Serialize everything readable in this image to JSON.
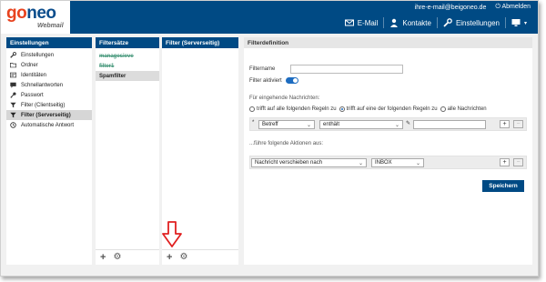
{
  "header": {
    "logo_part1": "go",
    "logo_part2": "neo",
    "logo_sub": "Webmail",
    "email": "ihre-e-mail@beigoneo.de",
    "logout": "Abmelden",
    "nav": {
      "email": "E-Mail",
      "contacts": "Kontakte",
      "settings": "Einstellungen"
    }
  },
  "settings_panel": {
    "title": "Einstellungen",
    "items": [
      {
        "label": "Einstellungen",
        "icon": "wrench-icon"
      },
      {
        "label": "Ordner",
        "icon": "folder-icon"
      },
      {
        "label": "Identitäten",
        "icon": "id-card-icon"
      },
      {
        "label": "Schnellantworten",
        "icon": "reply-icon"
      },
      {
        "label": "Passwort",
        "icon": "key-icon"
      },
      {
        "label": "Filter (Clientseitig)",
        "icon": "filter-icon"
      },
      {
        "label": "Filter (Serverseitig)",
        "icon": "filter-icon"
      },
      {
        "label": "Automatische Antwort",
        "icon": "clock-icon"
      }
    ],
    "active_index": 6
  },
  "filtersets": {
    "title": "Filtersätze",
    "items": [
      "managesieve",
      "filter1",
      "Spamfilter"
    ],
    "selected_index": 2
  },
  "serverfilters": {
    "title": "Filter (Serverseitig)"
  },
  "filterdef": {
    "title": "Filterdefinition",
    "name_label": "Filtername",
    "name_value": "",
    "active_label": "Filter aktiviert",
    "incoming_label": "Für eingehende Nachrichten:",
    "radio_all_rules": "trifft auf alle folgenden Regeln zu",
    "radio_any_rule": "trifft auf eine der folgenden Regeln zu",
    "radio_all_messages": "alle Nachrichten",
    "rule_field": "Betreff",
    "rule_op": "enthält",
    "rule_value": "",
    "actions_label": "...führe folgende Aktionen aus:",
    "action": "Nachricht verschieben nach",
    "action_target": "INBOX",
    "save": "Speichern"
  },
  "colors": {
    "primary": "#004a84",
    "accent": "#e8431f",
    "arrow": "#e02020"
  }
}
